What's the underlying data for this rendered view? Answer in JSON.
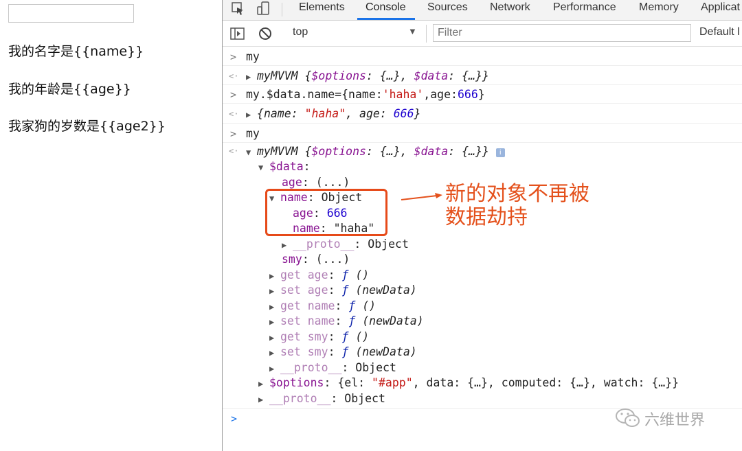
{
  "page": {
    "input_value": "",
    "lines": [
      "我的名字是{{name}}",
      "我的年龄是{{age}}",
      "我家狗的岁数是{{age2}}"
    ]
  },
  "devtools": {
    "tabs": [
      "Elements",
      "Console",
      "Sources",
      "Network",
      "Performance",
      "Memory",
      "Applicat"
    ],
    "active_tab": "Console",
    "context": "top",
    "filter_placeholder": "Filter",
    "levels": "Default l",
    "icons": [
      "inspect-element-icon",
      "device-toggle-icon",
      "sidebar-toggle-icon",
      "clear-console-icon",
      "dropdown-arrow-icon",
      "info-icon",
      "expand-triangle-icon",
      "collapse-triangle-icon"
    ]
  },
  "console": {
    "cmd1": "my",
    "out1": {
      "name": "myMVVM",
      "options": "$options",
      "data": "$data",
      "ellipsis": "{…}"
    },
    "cmd2": {
      "prefix": "my.$data.name=",
      "obj_open": "{name:",
      "name_val": "'haha'",
      "age_key": ",age:",
      "age_val": "666",
      "close": "}"
    },
    "out2": {
      "name_key": "name",
      "name_val": "\"haha\"",
      "age_key": "age",
      "age_val": "666"
    },
    "cmd3": "my",
    "out3_name": "myMVVM",
    "tree": {
      "data_key": "$data",
      "age_lazy": "age",
      "lazy": "(...)",
      "name_key": "name",
      "object_label": "Object",
      "child_age_key": "age",
      "child_age_val": "666",
      "child_name_key": "name",
      "child_name_val": "\"haha\"",
      "proto": "__proto__",
      "smy_lazy": "smy",
      "accessors": [
        {
          "kind": "get",
          "prop": "age",
          "sig": "()"
        },
        {
          "kind": "set",
          "prop": "age",
          "sig": "(newData)"
        },
        {
          "kind": "get",
          "prop": "name",
          "sig": "()"
        },
        {
          "kind": "set",
          "prop": "name",
          "sig": "(newData)"
        },
        {
          "kind": "get",
          "prop": "smy",
          "sig": "()"
        },
        {
          "kind": "set",
          "prop": "smy",
          "sig": "(newData)"
        }
      ],
      "f_glyph": "ƒ",
      "options_key": "$options",
      "options_el": "\"#app\"",
      "options_rest": "data: {…}, computed: {…}, watch: {…}}"
    }
  },
  "annotation": {
    "line1": "新的对象不再被",
    "line2": "数据劫持"
  },
  "watermark": "六维世界",
  "colors": {
    "annotation": "#e4511c",
    "box": "#e64a19",
    "purple_key": "#881391",
    "string": "#c41a16",
    "number": "#1c00cf",
    "active_tab_underline": "#1a73e8"
  }
}
